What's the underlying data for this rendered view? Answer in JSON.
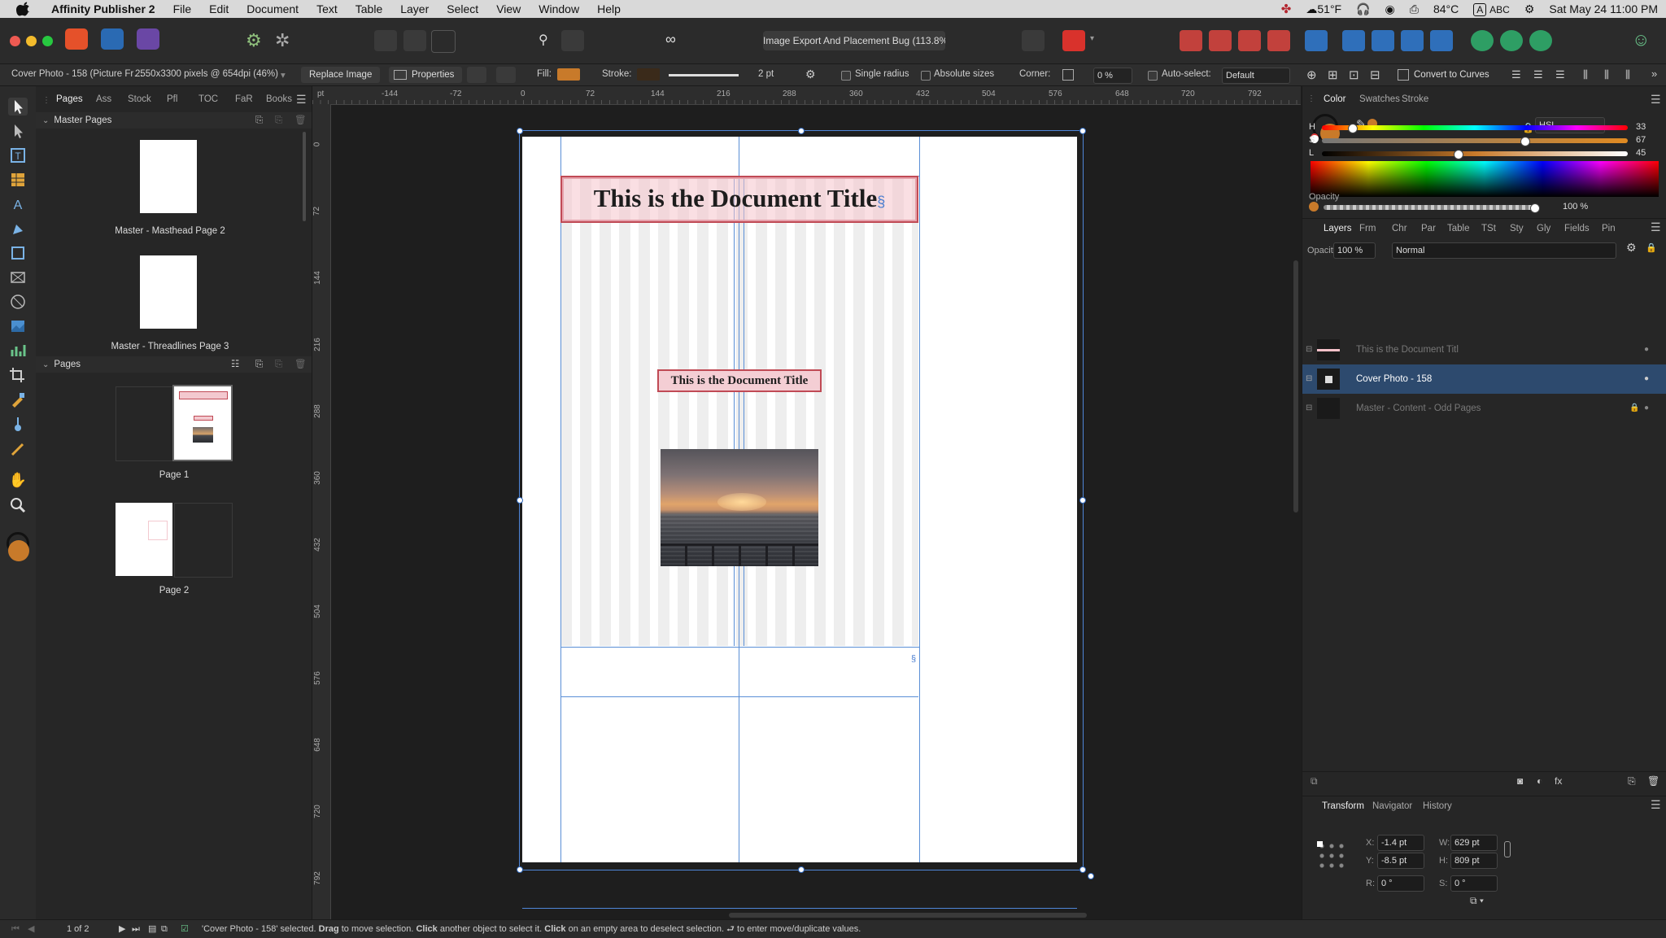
{
  "menubar": {
    "app_name": "Affinity Publisher 2",
    "items": [
      "File",
      "Edit",
      "Document",
      "Text",
      "Table",
      "Layer",
      "Select",
      "View",
      "Window",
      "Help"
    ],
    "weather": "51°F",
    "temperature": "84°C",
    "input_label": "ABC",
    "datetime": "Sat May 24  11:00 PM"
  },
  "toolbar": {
    "document_title": "Image Export And Placement Bug (113.8% ∗"
  },
  "context": {
    "selection_info": "Cover Photo - 158 (Picture Fr…",
    "pixel_info": "2550x3300 pixels @ 654dpi (46%)",
    "replace_image": "Replace Image",
    "properties": "Properties",
    "fill_label": "Fill:",
    "stroke_label": "Stroke:",
    "stroke_width": "2 pt",
    "single_radius": "Single radius",
    "absolute_sizes": "Absolute sizes",
    "corner_label": "Corner:",
    "corner_value": "0 %",
    "auto_select": "Auto-select:",
    "auto_select_value": "Default",
    "convert_to_curves": "Convert to Curves",
    "fill_color": "#c87a2a",
    "stroke_color": "#3a2a1a"
  },
  "left_panel": {
    "tabs": [
      "Pages",
      "Ass",
      "Stock",
      "Pfl",
      "TOC",
      "FaR",
      "Books"
    ],
    "master_pages_header": "Master Pages",
    "master_pages": [
      "Master - Masthead Page 2",
      "Master - Threadlines Page 3"
    ],
    "pages_header": "Pages",
    "pages": [
      "Page 1",
      "Page 2"
    ]
  },
  "rulers": {
    "unit": "pt",
    "h_ticks": [
      "-144",
      "-72",
      "0",
      "72",
      "144",
      "216",
      "288",
      "360",
      "432",
      "504",
      "576",
      "648",
      "720",
      "792"
    ],
    "v_ticks": [
      "0",
      "72",
      "144",
      "216",
      "288",
      "360",
      "432",
      "504",
      "576",
      "648",
      "720",
      "792"
    ]
  },
  "document": {
    "header_title": "This is the Document Title",
    "header_mark": "§",
    "inline_title": "This is the Document Title",
    "footer_mark": "§"
  },
  "right_panel": {
    "color_tabs": [
      "Color",
      "Swatches",
      "Stroke"
    ],
    "color_mode": "HSL",
    "h_label": "H",
    "h_value": "33",
    "s_label": "S",
    "s_value": "67",
    "l_label": "L",
    "l_value": "45",
    "opacity_label": "Opacity",
    "opacity_value": "100 %",
    "layer_tabs": [
      "Layers",
      "Frm",
      "Chr",
      "Par",
      "Table",
      "TSt",
      "Sty",
      "Gly",
      "Fields",
      "Pin"
    ],
    "layers_opacity_label": "Opacity:",
    "layers_opacity_value": "100 %",
    "blend_mode": "Normal",
    "layers": [
      {
        "name": "This is the Document Titl"
      },
      {
        "name": "Cover Photo - 158"
      },
      {
        "name": "Master - Content - Odd Pages"
      }
    ],
    "transform_tabs": [
      "Transform",
      "Navigator",
      "History"
    ],
    "transform": {
      "x_label": "X:",
      "x": "-1.4 pt",
      "y_label": "Y:",
      "y": "-8.5 pt",
      "w_label": "W:",
      "w": "629 pt",
      "h_label": "H:",
      "h": "809 pt",
      "r_label": "R:",
      "r": "0 °",
      "s_label": "S:",
      "s": "0 °"
    },
    "current_color": "#c87a2a"
  },
  "statusbar": {
    "page_count": "1 of 2",
    "message_pre": "'Cover Photo - 158' selected.",
    "drag": "Drag",
    "message_mid1": "to move selection.",
    "click1": "Click",
    "message_mid2": "another object to select it.",
    "click2": "Click",
    "message_end": "on an empty area to deselect selection. ⮐ to enter move/duplicate values."
  }
}
